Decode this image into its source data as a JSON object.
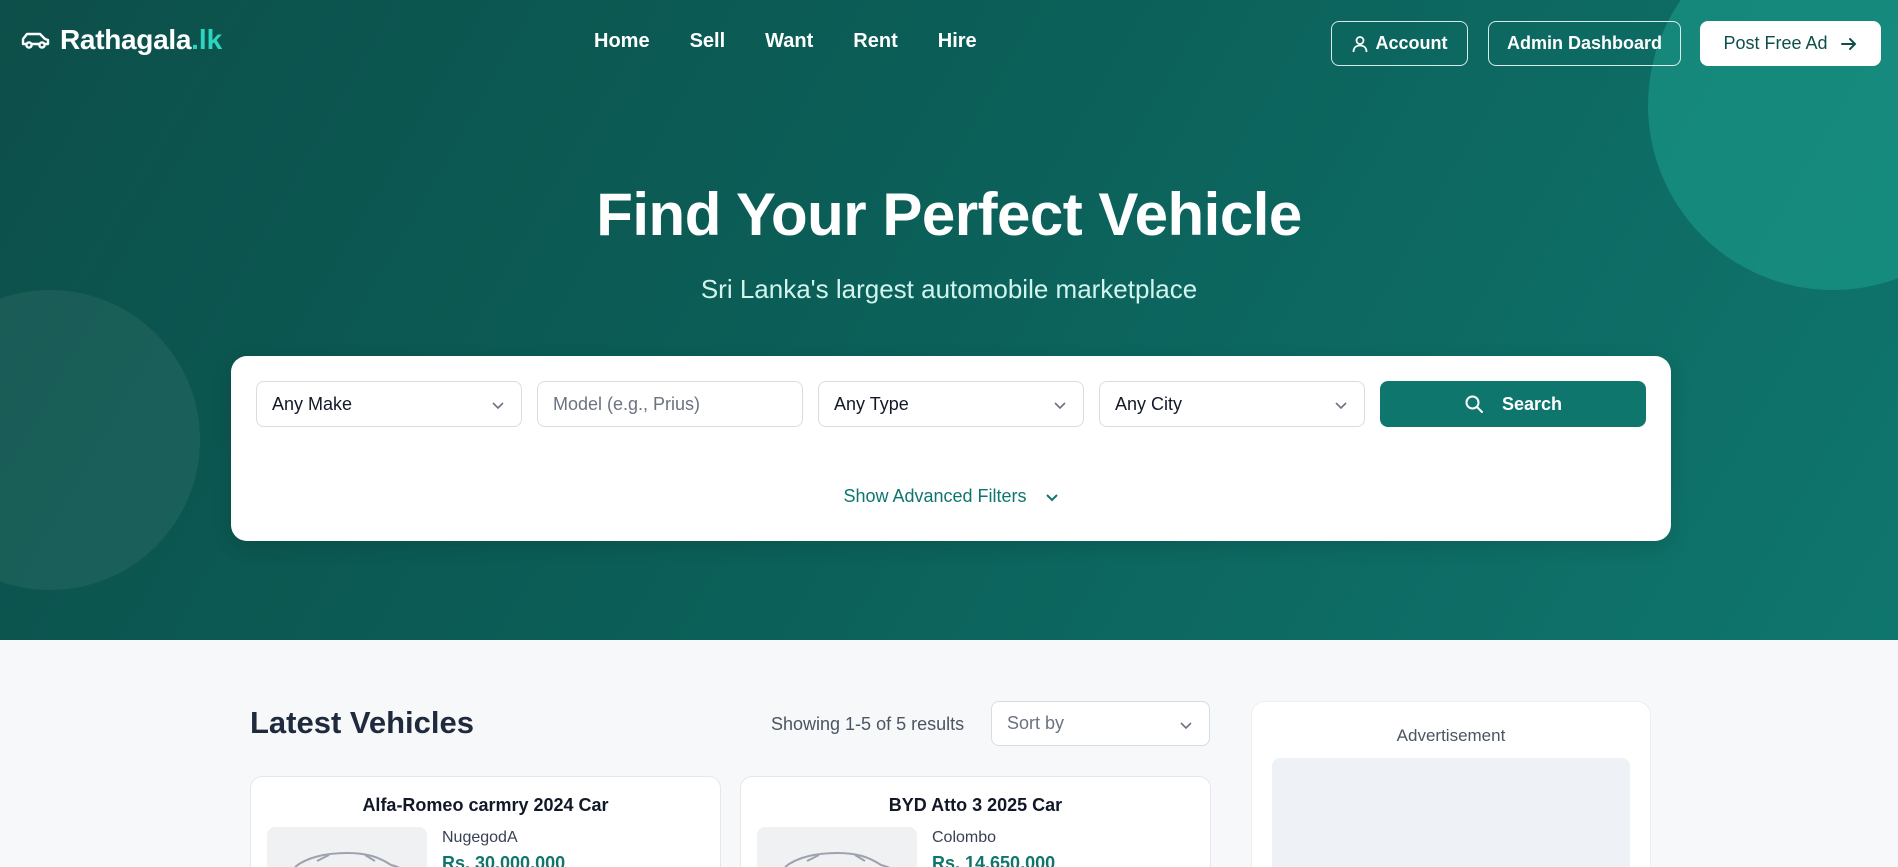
{
  "brand": {
    "name": "Rathagala",
    "tld": ".lk",
    "icon": "car-icon"
  },
  "nav": {
    "links": [
      "Home",
      "Sell",
      "Want",
      "Rent",
      "Hire"
    ]
  },
  "header_actions": {
    "account_label": "Account",
    "admin_label": "Admin Dashboard",
    "post_label": "Post Free Ad"
  },
  "hero": {
    "title": "Find Your Perfect Vehicle",
    "subtitle": "Sri Lanka's largest automobile marketplace"
  },
  "search": {
    "make_value": "Any Make",
    "model_placeholder": "Model (e.g., Prius)",
    "type_value": "Any Type",
    "city_value": "Any City",
    "button_label": "Search",
    "advanced_label": "Show Advanced Filters"
  },
  "listings": {
    "title": "Latest Vehicles",
    "results_text": "Showing 1-5 of 5 results",
    "sort_placeholder": "Sort by",
    "items": [
      {
        "title": "Alfa-Romeo carmry 2024 Car",
        "city": "NugegodA",
        "price": "Rs. 30,000,000"
      },
      {
        "title": "BYD Atto 3 2025 Car",
        "city": "Colombo",
        "price": "Rs. 14,650,000"
      }
    ]
  },
  "sidebar": {
    "ad_label": "Advertisement"
  },
  "colors": {
    "primary": "#0f766e",
    "hero_dark": "#0d4f4a",
    "accent": "#2dd4bf"
  }
}
